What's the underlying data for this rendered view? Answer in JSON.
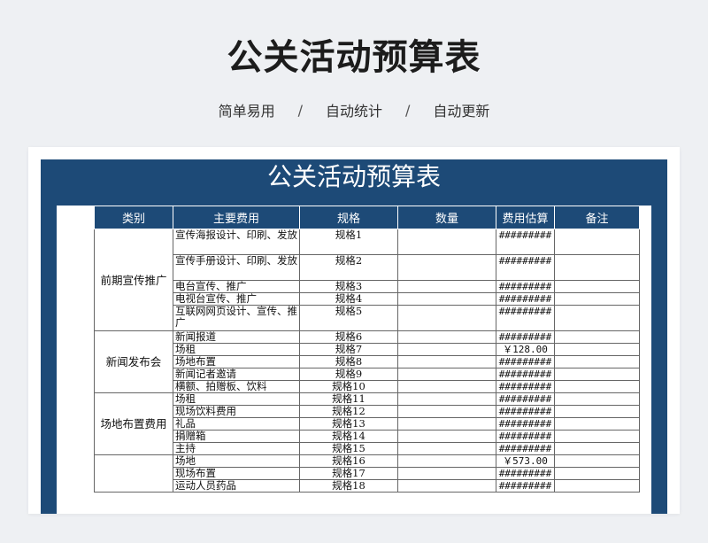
{
  "header": {
    "title": "公关活动预算表",
    "features": [
      "简单易用",
      "自动统计",
      "自动更新"
    ],
    "separator": "/"
  },
  "sheet": {
    "title": "公关活动预算表",
    "columns": [
      "类别",
      "主要费用",
      "规格",
      "数量",
      "费用估算",
      "备注"
    ],
    "groups": [
      {
        "category": "前期宣传推广",
        "rows": [
          {
            "item": "宣传海报设计、印刷、发放",
            "spec": "规格1",
            "qty": "",
            "estimate": "#########",
            "note": ""
          },
          {
            "item": "宣传手册设计、印刷、发放",
            "spec": "规格2",
            "qty": "",
            "estimate": "#########",
            "note": ""
          },
          {
            "item": "电台宣传、推广",
            "spec": "规格3",
            "qty": "",
            "estimate": "#########",
            "note": ""
          },
          {
            "item": "电视台宣传、推广",
            "spec": "规格4",
            "qty": "",
            "estimate": "#########",
            "note": ""
          },
          {
            "item": "互联网网页设计、宣传、推广",
            "spec": "规格5",
            "qty": "",
            "estimate": "#########",
            "note": ""
          }
        ]
      },
      {
        "category": "新闻发布会",
        "rows": [
          {
            "item": "新闻报道",
            "spec": "规格6",
            "qty": "",
            "estimate": "#########",
            "note": ""
          },
          {
            "item": "场租",
            "spec": "规格7",
            "qty": "",
            "estimate": "￥128.00",
            "note": ""
          },
          {
            "item": "场地布置",
            "spec": "规格8",
            "qty": "",
            "estimate": "#########",
            "note": ""
          },
          {
            "item": "新闻记者邀请",
            "spec": "规格9",
            "qty": "",
            "estimate": "#########",
            "note": ""
          },
          {
            "item": "横额、拍赠板、饮料",
            "spec": "规格10",
            "qty": "",
            "estimate": "#########",
            "note": ""
          }
        ]
      },
      {
        "category": "场地布置费用",
        "rows": [
          {
            "item": "场租",
            "spec": "规格11",
            "qty": "",
            "estimate": "#########",
            "note": ""
          },
          {
            "item": "现场饮料费用",
            "spec": "规格12",
            "qty": "",
            "estimate": "#########",
            "note": ""
          },
          {
            "item": "礼品",
            "spec": "规格13",
            "qty": "",
            "estimate": "#########",
            "note": ""
          },
          {
            "item": "捐赠箱",
            "spec": "规格14",
            "qty": "",
            "estimate": "#########",
            "note": ""
          },
          {
            "item": "主持",
            "spec": "规格15",
            "qty": "",
            "estimate": "#########",
            "note": ""
          }
        ]
      },
      {
        "category": "",
        "rows": [
          {
            "item": "场地",
            "spec": "规格16",
            "qty": "",
            "estimate": "￥573.00",
            "note": ""
          },
          {
            "item": "现场布置",
            "spec": "规格17",
            "qty": "",
            "estimate": "#########",
            "note": ""
          },
          {
            "item": "运动人员药品",
            "spec": "规格18",
            "qty": "",
            "estimate": "#########",
            "note": ""
          }
        ]
      }
    ]
  }
}
